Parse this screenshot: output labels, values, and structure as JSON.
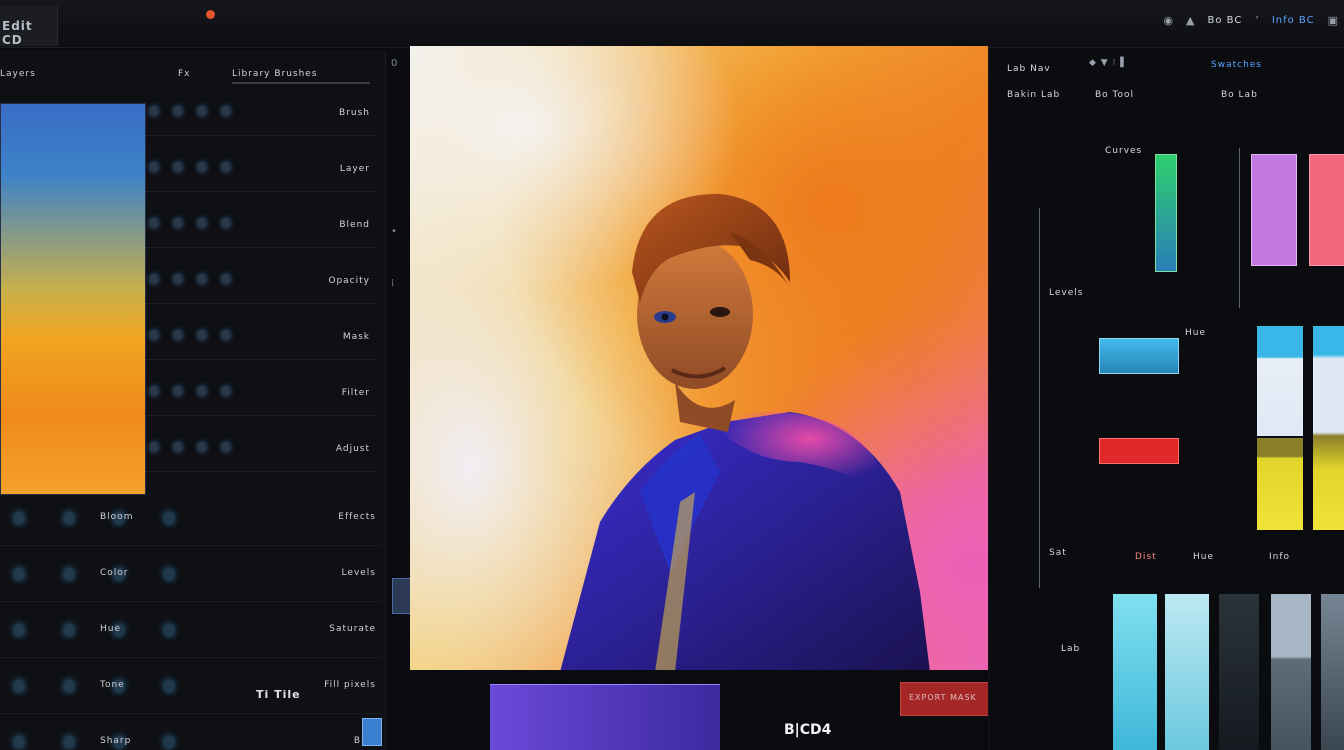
{
  "window": {
    "app_tab": "Edit CD",
    "toolbar_labels": [
      "Bo BC",
      "Info BC"
    ]
  },
  "left_panel": {
    "header": {
      "title": "Layers",
      "mode": "Fx",
      "library": "Library Brushes"
    },
    "rows": [
      "Brush",
      "Layer",
      "Blend",
      "Opacity",
      "Mask",
      "Filter",
      "Adjust"
    ],
    "lower_rows": [
      {
        "left": "Bloom",
        "right": "Effects"
      },
      {
        "left": "Color",
        "right": "Levels"
      },
      {
        "left": "Hue",
        "right": "Saturate"
      },
      {
        "left": "Tone",
        "right": "Fill pixels"
      },
      {
        "left": "Sharp",
        "right": "Blur"
      }
    ],
    "bottom_label": "Ti Tile"
  },
  "canvas": {
    "subject": "portrait",
    "base_label": "B|CD4",
    "red_chip_label": "EXPORT MASK"
  },
  "right_panel": {
    "header": [
      "Lab Nav",
      "Bakin Lab",
      "Bo Tool",
      "Bo Lab"
    ],
    "palette_label": "Swatches",
    "mid_labels": [
      "Curves",
      "Levels",
      "Hue"
    ],
    "footer_labels": [
      "Sat",
      "Dist",
      "Hue",
      "Info",
      "Lab"
    ],
    "colors": {
      "green_blue": "#2ecf6e",
      "violet": "#c27ae0",
      "pink": "#f2687e",
      "cyan": "#39b7e8",
      "red": "#e02a2a",
      "yellow": "#e2d42a"
    }
  }
}
